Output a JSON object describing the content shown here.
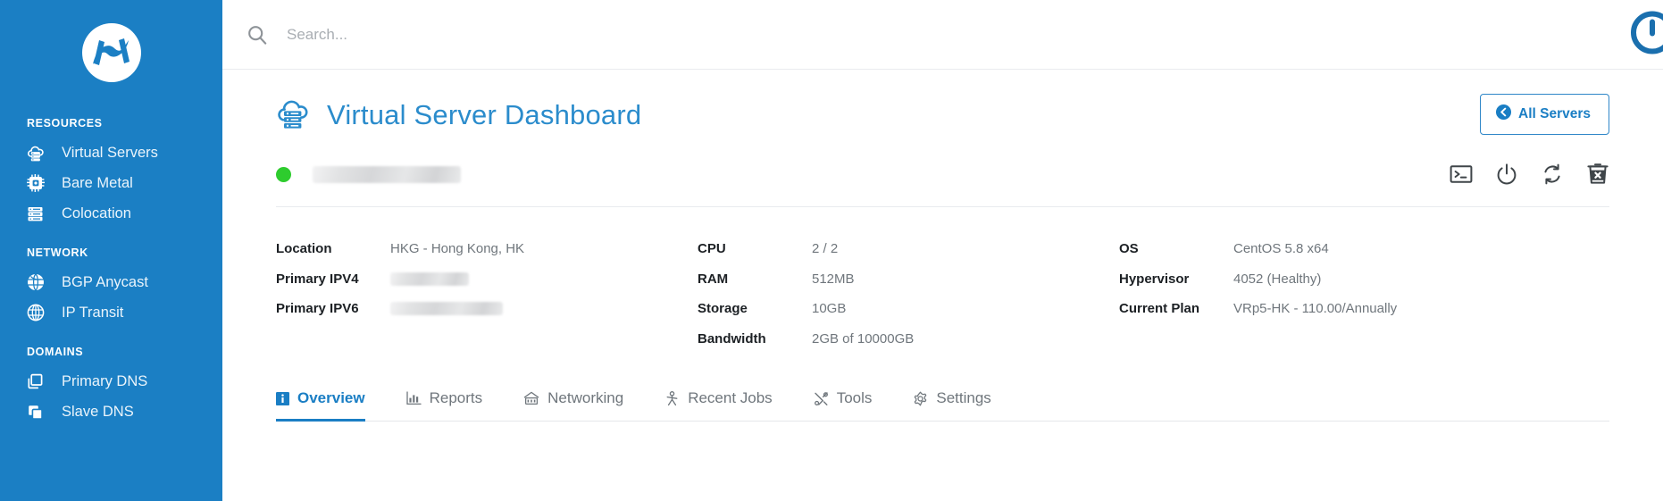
{
  "sidebar": {
    "logo_name": "company-logo",
    "groups": [
      {
        "title": "RESOURCES",
        "items": [
          {
            "label": "Virtual Servers",
            "icon": "cloud-server-icon"
          },
          {
            "label": "Bare Metal",
            "icon": "cpu-chip-icon"
          },
          {
            "label": "Colocation",
            "icon": "server-rack-icon"
          }
        ]
      },
      {
        "title": "NETWORK",
        "items": [
          {
            "label": "BGP Anycast",
            "icon": "globe-filled-icon"
          },
          {
            "label": "IP Transit",
            "icon": "globe-outline-icon"
          }
        ]
      },
      {
        "title": "DOMAINS",
        "items": [
          {
            "label": "Primary DNS",
            "icon": "copy-outline-icon"
          },
          {
            "label": "Slave DNS",
            "icon": "copy-filled-icon"
          }
        ]
      }
    ]
  },
  "topbar": {
    "search_placeholder": "Search...",
    "search_value": "",
    "search_icon": "search-icon",
    "power_icon": "power-logout-icon"
  },
  "page": {
    "title": "Virtual Server Dashboard",
    "title_icon": "cloud-server-icon",
    "all_servers_label": "All Servers",
    "all_servers_icon": "arrow-circle-left-icon"
  },
  "server": {
    "status": "online",
    "status_color": "#2ecc2e",
    "name": "",
    "actions": [
      {
        "name": "console-icon",
        "label": "Console"
      },
      {
        "name": "power-icon",
        "label": "Power"
      },
      {
        "name": "reboot-icon",
        "label": "Reboot"
      },
      {
        "name": "delete-icon",
        "label": "Delete"
      }
    ]
  },
  "details": {
    "col1": [
      {
        "label": "Location",
        "value": "HKG - Hong Kong, HK",
        "redacted": false
      },
      {
        "label": "Primary IPV4",
        "value": "",
        "redacted": true
      },
      {
        "label": "Primary IPV6",
        "value": "",
        "redacted": true
      }
    ],
    "col2": [
      {
        "label": "CPU",
        "value": "2 / 2",
        "redacted": false
      },
      {
        "label": "RAM",
        "value": "512MB",
        "redacted": false
      },
      {
        "label": "Storage",
        "value": "10GB",
        "redacted": false
      },
      {
        "label": "Bandwidth",
        "value": "2GB of 10000GB",
        "redacted": false
      }
    ],
    "col3": [
      {
        "label": "OS",
        "value": "CentOS 5.8 x64",
        "redacted": false
      },
      {
        "label": "Hypervisor",
        "value": "4052 (Healthy)",
        "redacted": false
      },
      {
        "label": "Current Plan",
        "value": "VRp5-HK - 110.00/Annually",
        "redacted": false
      }
    ]
  },
  "tabs": [
    {
      "label": "Overview",
      "icon": "info-square-icon",
      "active": true
    },
    {
      "label": "Reports",
      "icon": "bar-chart-icon",
      "active": false
    },
    {
      "label": "Networking",
      "icon": "network-icon",
      "active": false
    },
    {
      "label": "Recent Jobs",
      "icon": "tasks-icon",
      "active": false
    },
    {
      "label": "Tools",
      "icon": "tools-icon",
      "active": false
    },
    {
      "label": "Settings",
      "icon": "gear-icon",
      "active": false
    }
  ],
  "colors": {
    "sidebar_blue": "#1b7fc4",
    "accent_blue": "#1a7ec4",
    "title_blue": "#2b8ccc",
    "status_green": "#2ecc2e",
    "text_dark": "#1c2024",
    "text_muted": "#6f767c"
  }
}
